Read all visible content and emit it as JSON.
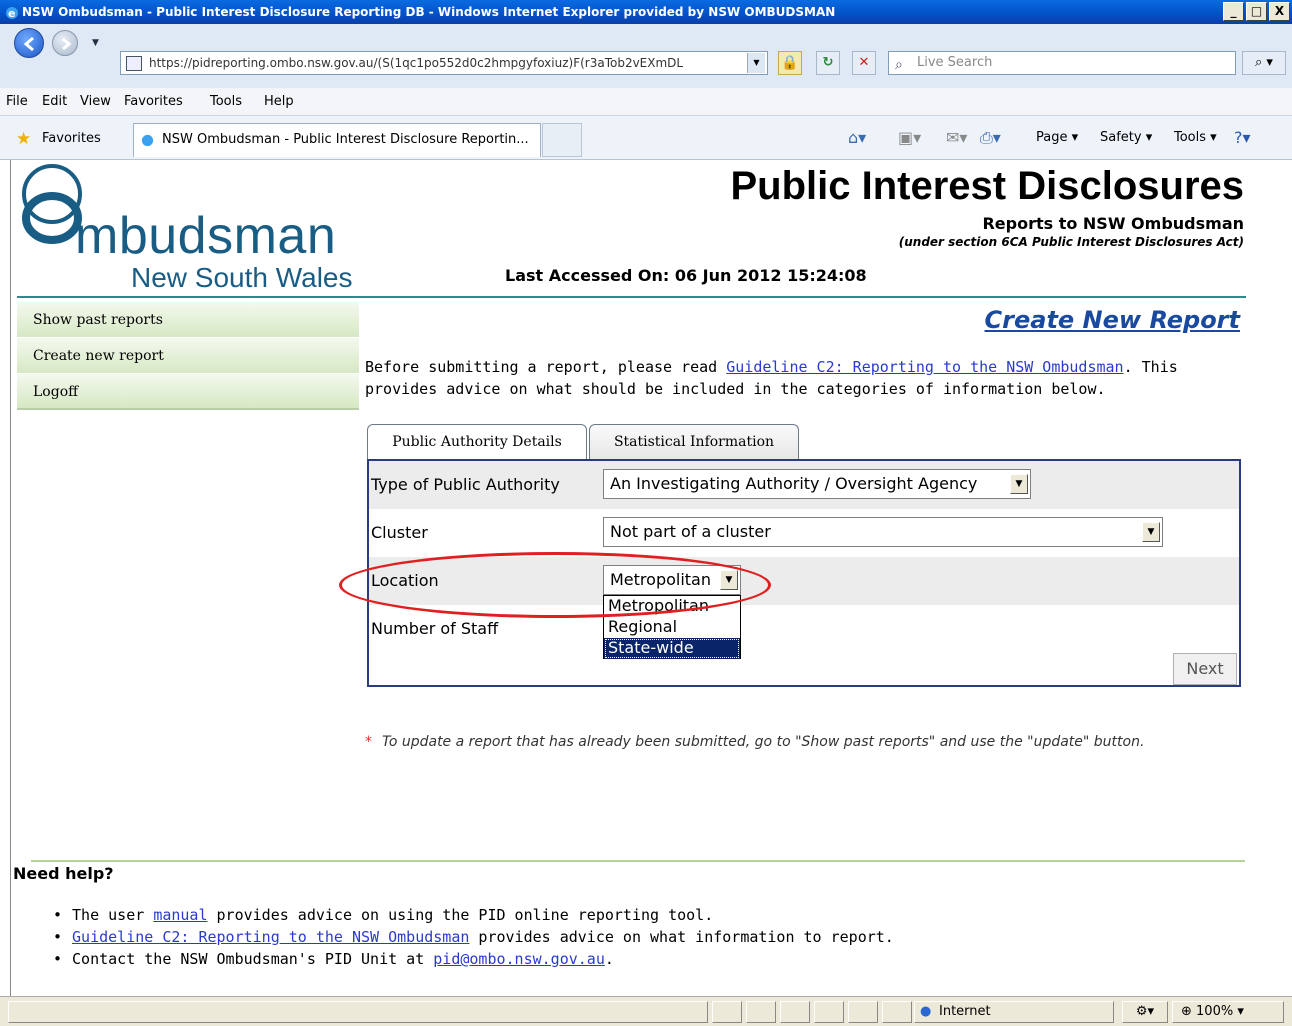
{
  "window": {
    "title": "NSW Ombudsman - Public Interest Disclosure Reporting DB - Windows Internet Explorer provided by NSW OMBUDSMAN",
    "controls": [
      "_",
      "□",
      "X"
    ]
  },
  "browser": {
    "url": "https://pidreporting.ombo.nsw.gov.au/(S(1qc1po552d0c2hmpgyfoxiuz)F(r3aTob2vEXmDL",
    "search_placeholder": "Live Search",
    "menu": [
      "File",
      "Edit",
      "View",
      "Favorites",
      "Tools",
      "Help"
    ],
    "favorites_label": "Favorites",
    "tab_title": "NSW Ombudsman - Public Interest Disclosure Reportin...",
    "commands": {
      "page": "Page",
      "safety": "Safety",
      "tools": "Tools"
    }
  },
  "logo": {
    "word": "mbudsman",
    "subtitle": "New South Wales"
  },
  "header": {
    "title": "Public Interest Disclosures",
    "subtitle": "Reports to NSW Ombudsman",
    "section_note": "(under section 6CA Public Interest Disclosures Act)",
    "last_accessed": "Last Accessed On: 06 Jun 2012 15:24:08"
  },
  "sidebar": {
    "items": [
      {
        "label": "Show past reports"
      },
      {
        "label": "Create new report"
      },
      {
        "label": "Logoff"
      }
    ]
  },
  "main": {
    "heading": "Create New Report",
    "intro_before": "Before submitting a report, please read ",
    "intro_link": "Guideline C2: Reporting to the NSW Ombudsman",
    "intro_after": ". This provides advice on what should be included in the categories of information below.",
    "tabs": [
      {
        "label": "Public Authority Details",
        "active": true
      },
      {
        "label": "Statistical Information",
        "active": false
      }
    ],
    "form": {
      "type_label": "Type of Public Authority",
      "type_value": "An Investigating Authority / Oversight Agency",
      "cluster_label": "Cluster",
      "cluster_value": "Not part of a cluster",
      "location_label": "Location",
      "location_value": "Metropolitan",
      "location_options": [
        "Metropolitan",
        "Regional",
        "State-wide"
      ],
      "location_highlighted": "State-wide",
      "staff_label": "Number of Staff",
      "next_label": "Next"
    },
    "note_asterisk": "*",
    "note": "To update a report that has already been submitted, go to \"Show past reports\" and use the \"update\" button."
  },
  "help": {
    "title": "Need help?",
    "line1_before": "The user ",
    "line1_link": "manual",
    "line1_after": " provides advice on using the PID online reporting tool.",
    "line2_link": "Guideline C2: Reporting to the NSW Ombudsman",
    "line2_after": " provides advice on what information to report.",
    "line3_before": "Contact the NSW Ombudsman's PID Unit at ",
    "line3_link": "pid@ombo.nsw.gov.au",
    "line3_after": "."
  },
  "status": {
    "zone": "Internet",
    "zoom": "100%"
  },
  "colors": {
    "annotation_ellipse": "#e02020",
    "logo": "#1a5d84",
    "link": "#2a3ad0"
  }
}
